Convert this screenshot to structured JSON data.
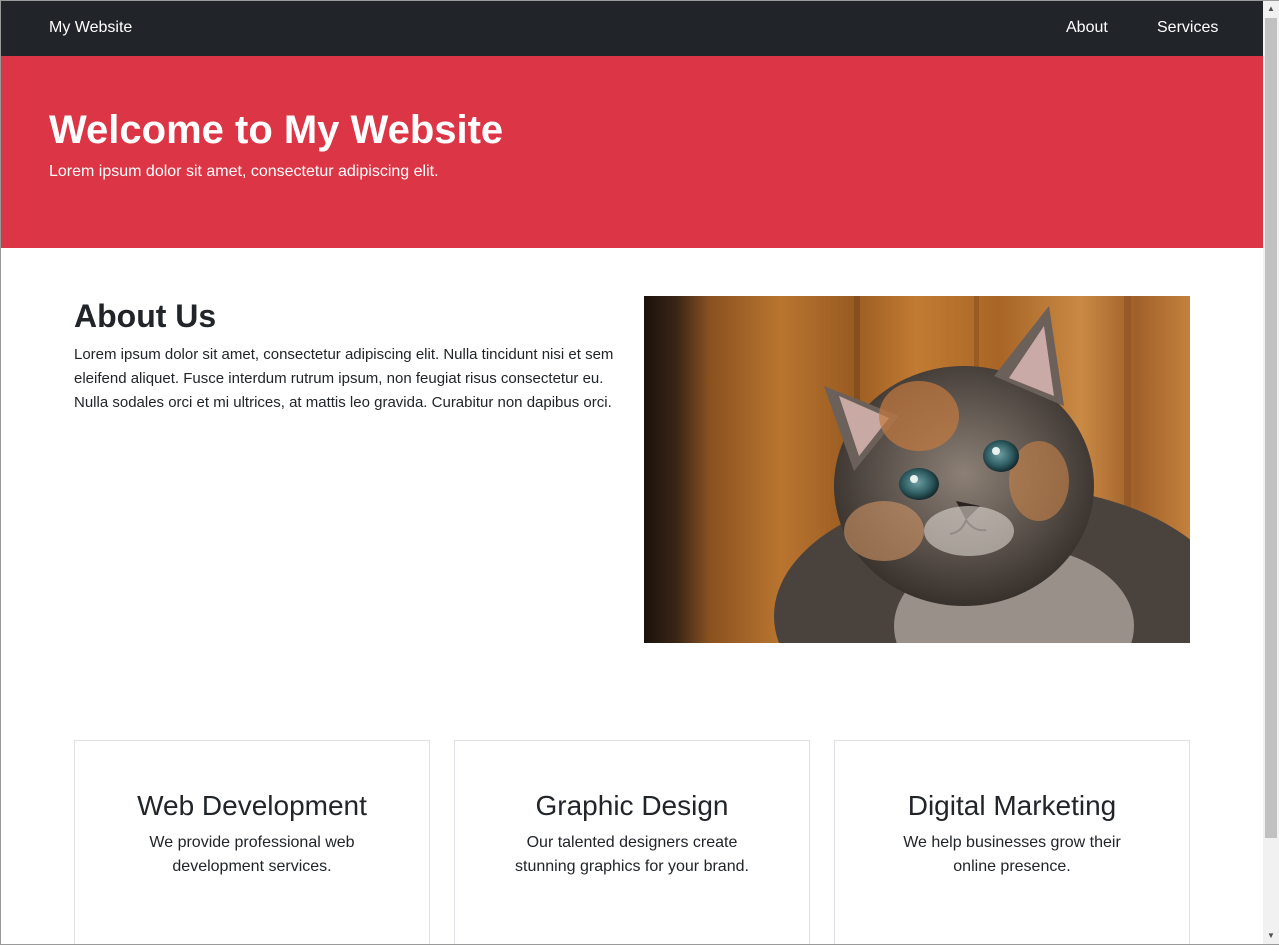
{
  "navbar": {
    "brand": "My Website",
    "links": [
      "About",
      "Services"
    ]
  },
  "hero": {
    "title": "Welcome to My Website",
    "subtitle": "Lorem ipsum dolor sit amet, consectetur adipiscing elit."
  },
  "about": {
    "title": "About Us",
    "text": "Lorem ipsum dolor sit amet, consectetur adipiscing elit. Nulla tincidunt nisi et sem eleifend aliquet. Fusce interdum rutrum ipsum, non feugiat risus consectetur eu. Nulla sodales orci et mi ultrices, at mattis leo gravida. Curabitur non dapibus orci."
  },
  "services": [
    {
      "title": "Web Development",
      "text": "We provide professional web development services."
    },
    {
      "title": "Graphic Design",
      "text": "Our talented designers create stunning graphics for your brand."
    },
    {
      "title": "Digital Marketing",
      "text": "We help businesses grow their online presence."
    }
  ],
  "colors": {
    "navbar": "#212529",
    "hero": "#dc3545",
    "text": "#212529",
    "card_border": "#dee2e6"
  },
  "icons": {
    "scroll_up": "scroll-up-arrow-icon",
    "scroll_down": "scroll-down-arrow-icon"
  }
}
